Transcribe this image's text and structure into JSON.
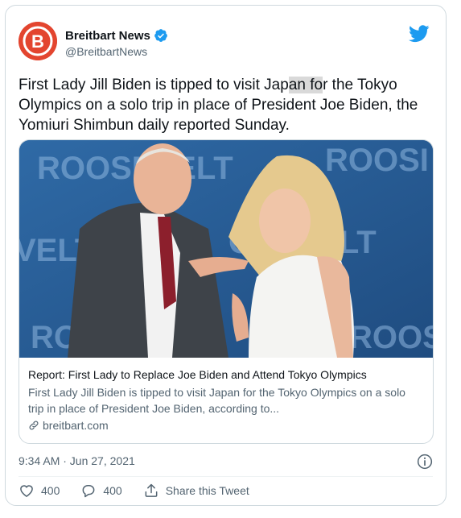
{
  "author": {
    "display_name": "Breitbart News",
    "handle": "@BreitbartNews",
    "avatar_letter": "B",
    "brand_color": "#e3452f",
    "verified_icon": "verified-badge-icon"
  },
  "tweet": {
    "text_before_highlight": "First Lady Jill Biden is tipped to visit Jap",
    "text_highlight": "an fo",
    "text_after_highlight": "r the Tokyo Olympics on a solo trip in place of President Joe Biden, the Yomiuri Shimbun daily reported Sunday."
  },
  "link_card": {
    "title": "Report: First Lady to Replace Joe Biden and Attend Tokyo Olympics",
    "description": "First Lady Jill Biden is tipped to visit Japan for the Tokyo Olympics on a solo trip in place of President Joe Biden, according to...",
    "domain": "breitbart.com",
    "image_backdrop_text": "ROOSEVELT INSTITUTE"
  },
  "meta": {
    "timestamp": "9:34 AM · Jun 27, 2021"
  },
  "actions": {
    "like_count": "400",
    "reply_count": "400",
    "share_label": "Share this Tweet"
  },
  "colors": {
    "twitter_blue": "#1d9bf0",
    "secondary_text": "#536471",
    "border": "#cfd9de"
  }
}
